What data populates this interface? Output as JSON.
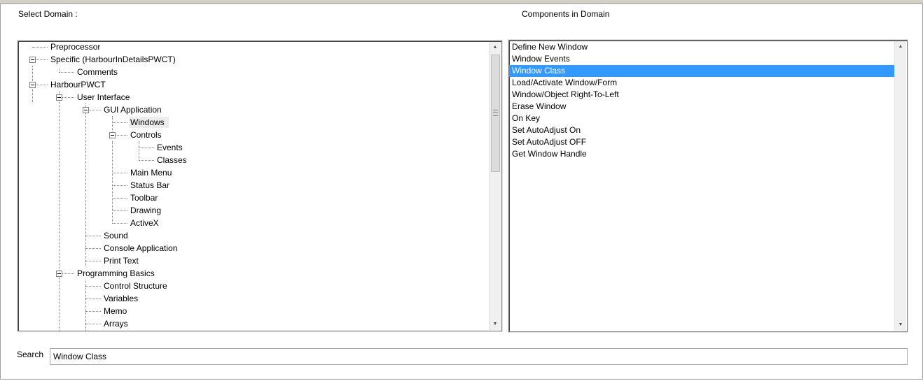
{
  "labels": {
    "select_domain": "Select Domain :",
    "components_in_domain": "Components in Domain",
    "search": "Search"
  },
  "tree": {
    "items": [
      "Preprocessor",
      "Specific (HarbourInDetailsPWCT)",
      "Comments",
      "HarbourPWCT",
      "User Interface",
      "GUI Application",
      "Windows",
      "Controls",
      "Events",
      "Classes",
      "Main Menu",
      "Status Bar",
      "Toolbar",
      "Drawing",
      "ActiveX",
      "Sound",
      "Console Application",
      "Print Text",
      "Programming Basics",
      "Control Structure",
      "Variables",
      "Memo",
      "Arrays"
    ],
    "selected": "Windows"
  },
  "components": {
    "items": [
      "Define New Window",
      "Window Events",
      "Window Class",
      "Load/Activate Window/Form",
      "Window/Object Right-To-Left",
      "Erase Window",
      "On Key",
      "Set AutoAdjust On",
      "Set AutoAdjust OFF",
      "Get Window Handle"
    ],
    "selected": "Window Class"
  },
  "search": {
    "value": "Window Class"
  },
  "icons": {
    "scroll_up": "scroll-up-arrow-icon",
    "scroll_down": "scroll-down-arrow-icon",
    "collapse": "collapse-minus-icon"
  },
  "colors": {
    "selection_background": "#3399ff",
    "tree_selection_background": "#ececec"
  }
}
